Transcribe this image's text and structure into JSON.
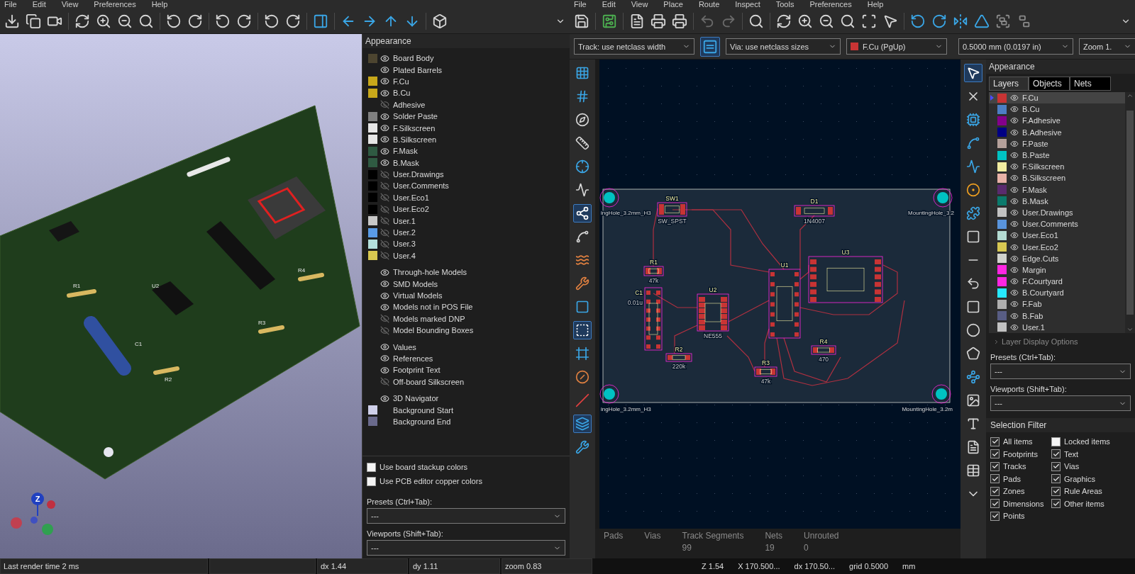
{
  "viewer": {
    "menus": [
      "File",
      "Edit",
      "View",
      "Preferences",
      "Help"
    ],
    "render_labels": [
      "R1",
      "U2",
      "R3",
      "R4",
      "R2",
      "C1"
    ],
    "navigator_axis": "Z",
    "appearance": {
      "title": "Appearance",
      "groups": [
        {
          "items": [
            {
              "label": "Board Body",
              "color": "#4d4530",
              "visible": true
            },
            {
              "label": "Plated Barrels",
              "visible": true
            },
            {
              "label": "F.Cu",
              "color": "#c8a81a",
              "visible": true
            },
            {
              "label": "B.Cu",
              "color": "#c8a81a",
              "visible": true
            },
            {
              "label": "Adhesive",
              "visible": false
            },
            {
              "label": "Solder Paste",
              "color": "#808080",
              "visible": true
            },
            {
              "label": "F.Silkscreen",
              "color": "#e6e6e6",
              "visible": true
            },
            {
              "label": "B.Silkscreen",
              "color": "#e6e6e6",
              "visible": true
            },
            {
              "label": "F.Mask",
              "color": "#2f5a42",
              "visible": true
            },
            {
              "label": "B.Mask",
              "color": "#2f5a42",
              "visible": true
            },
            {
              "label": "User.Drawings",
              "color": "#000000",
              "visible": false
            },
            {
              "label": "User.Comments",
              "color": "#000000",
              "visible": false
            },
            {
              "label": "User.Eco1",
              "color": "#000000",
              "visible": false
            },
            {
              "label": "User.Eco2",
              "color": "#000000",
              "visible": false
            },
            {
              "label": "User.1",
              "color": "#c8c8c8",
              "visible": false
            },
            {
              "label": "User.2",
              "color": "#5a9be6",
              "visible": false
            },
            {
              "label": "User.3",
              "color": "#b4e0dc",
              "visible": false
            },
            {
              "label": "User.4",
              "color": "#d8c850",
              "visible": false
            }
          ]
        },
        {
          "items": [
            {
              "label": "Through-hole Models",
              "visible": true
            },
            {
              "label": "SMD Models",
              "visible": true
            },
            {
              "label": "Virtual Models",
              "visible": true
            },
            {
              "label": "Models not in POS File",
              "visible": true
            },
            {
              "label": "Models marked DNP",
              "visible": false
            },
            {
              "label": "Model Bounding Boxes",
              "visible": false
            }
          ]
        },
        {
          "items": [
            {
              "label": "Values",
              "visible": true
            },
            {
              "label": "References",
              "visible": true
            },
            {
              "label": "Footprint Text",
              "visible": true
            },
            {
              "label": "Off-board Silkscreen",
              "visible": false
            }
          ]
        },
        {
          "items": [
            {
              "label": "3D Navigator",
              "visible": true
            },
            {
              "label": "Background Start",
              "color": "#cfd0ea"
            },
            {
              "label": "Background End",
              "color": "#6a6a8c"
            }
          ]
        }
      ],
      "options": [
        {
          "label": "Use board stackup colors",
          "checked": false
        },
        {
          "label": "Use PCB editor copper colors",
          "checked": false
        }
      ],
      "presets": {
        "label": "Presets (Ctrl+Tab):",
        "value": "---"
      },
      "viewports": {
        "label": "Viewports (Shift+Tab):",
        "value": "---"
      }
    }
  },
  "pcb": {
    "menus": [
      "File",
      "Edit",
      "View",
      "Place",
      "Route",
      "Inspect",
      "Tools",
      "Preferences",
      "Help"
    ],
    "track": "Track: use netclass width",
    "via": "Via: use netclass sizes",
    "layer": {
      "label": "F.Cu (PgUp)",
      "color": "#c83434"
    },
    "grid": "0.5000 mm (0.0197 in)",
    "zoom": "Zoom 1.",
    "footprints": [
      {
        "ref": "SW1",
        "value": "SW_SPST"
      },
      {
        "ref": "D1",
        "value": "1N4007"
      },
      {
        "ref": "R1",
        "value": "47k"
      },
      {
        "ref": "C1",
        "value": "0.01u"
      },
      {
        "ref": "U2",
        "value": "NE555"
      },
      {
        "ref": "R2",
        "value": "220k"
      },
      {
        "ref": "R3",
        "value": "47k"
      },
      {
        "ref": "U1"
      },
      {
        "ref": "U3"
      },
      {
        "ref": "R4",
        "value": "470"
      }
    ],
    "mounting_holes": [
      "ingHole_3.2mm_H3",
      "MountingHole_3.2",
      "ingHole_3.2mm_H3",
      "MountingHole_3.2m"
    ],
    "messages": [
      {
        "label": "Pads"
      },
      {
        "label": "Vias"
      },
      {
        "label": "Track Segments",
        "value": "99"
      },
      {
        "label": "Nets",
        "value": "19"
      },
      {
        "label": "Unrouted",
        "value": "0"
      }
    ],
    "appearance": {
      "title": "Appearance",
      "tabs": [
        {
          "label": "Layers",
          "selected": true
        },
        {
          "label": "Objects",
          "selected": false
        },
        {
          "label": "Nets",
          "selected": false
        }
      ],
      "layers": [
        {
          "label": "F.Cu",
          "color": "#c83434",
          "visible": true,
          "selected": true
        },
        {
          "label": "B.Cu",
          "color": "#4d7fc4",
          "visible": true,
          "selected": false
        },
        {
          "label": "F.Adhesive",
          "color": "#84008b",
          "visible": true,
          "selected": false
        },
        {
          "label": "B.Adhesive",
          "color": "#000084",
          "visible": true,
          "selected": false
        },
        {
          "label": "F.Paste",
          "color": "#b4a09a",
          "visible": true,
          "selected": false
        },
        {
          "label": "B.Paste",
          "color": "#00c2c2",
          "visible": true,
          "selected": false
        },
        {
          "label": "F.Silkscreen",
          "color": "#f2eda1",
          "visible": true,
          "selected": false
        },
        {
          "label": "B.Silkscreen",
          "color": "#e8b2a7",
          "visible": true,
          "selected": false
        },
        {
          "label": "F.Mask",
          "color": "#5a2a6e",
          "visible": true,
          "selected": false
        },
        {
          "label": "B.Mask",
          "color": "#0b7a6c",
          "visible": true,
          "selected": false
        },
        {
          "label": "User.Drawings",
          "color": "#c2c2c2",
          "visible": true,
          "selected": false
        },
        {
          "label": "User.Comments",
          "color": "#5994dc",
          "visible": true,
          "selected": false
        },
        {
          "label": "User.Eco1",
          "color": "#b4dbd2",
          "visible": true,
          "selected": false
        },
        {
          "label": "User.Eco2",
          "color": "#d8c852",
          "visible": true,
          "selected": false
        },
        {
          "label": "Edge.Cuts",
          "color": "#d0d2cd",
          "visible": true,
          "selected": false
        },
        {
          "label": "Margin",
          "color": "#ff26e2",
          "visible": true,
          "selected": false
        },
        {
          "label": "F.Courtyard",
          "color": "#ff26e2",
          "visible": true,
          "selected": false
        },
        {
          "label": "B.Courtyard",
          "color": "#26e9ff",
          "visible": true,
          "selected": false
        },
        {
          "label": "F.Fab",
          "color": "#afafaf",
          "visible": true,
          "selected": false
        },
        {
          "label": "B.Fab",
          "color": "#585d84",
          "visible": true,
          "selected": false
        },
        {
          "label": "User.1",
          "color": "#c2c2c2",
          "visible": true,
          "selected": false
        }
      ],
      "display_options": {
        "label": "Layer Display Options",
        "expanded": false
      },
      "presets": {
        "label": "Presets (Ctrl+Tab):",
        "value": "---"
      },
      "viewports": {
        "label": "Viewports (Shift+Tab):",
        "value": "---"
      },
      "selection_filter": {
        "title": "Selection Filter",
        "items": [
          {
            "label": "All items",
            "checked": true
          },
          {
            "label": "Locked items",
            "checked": false
          },
          {
            "label": "Footprints",
            "checked": true
          },
          {
            "label": "Text",
            "checked": true
          },
          {
            "label": "Tracks",
            "checked": true
          },
          {
            "label": "Vias",
            "checked": true
          },
          {
            "label": "Pads",
            "checked": true
          },
          {
            "label": "Graphics",
            "checked": true
          },
          {
            "label": "Zones",
            "checked": true
          },
          {
            "label": "Rule Areas",
            "checked": true
          },
          {
            "label": "Dimensions",
            "checked": true
          },
          {
            "label": "Other items",
            "checked": true
          },
          {
            "label": "Points",
            "checked": true
          }
        ]
      }
    }
  },
  "status_bar": {
    "viewer": [
      "Last render time 2 ms",
      "dx 1.44",
      "dy 1.11",
      "zoom 0.83"
    ],
    "pcb": [
      "Z 1.54",
      "X 170.500...",
      "dx 170.50...",
      "grid 0.5000",
      "mm"
    ]
  }
}
